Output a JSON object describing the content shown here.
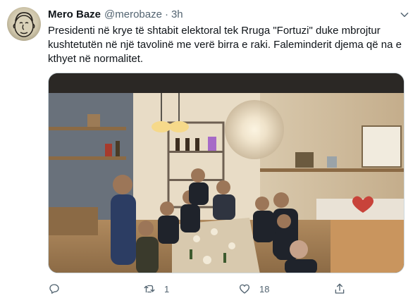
{
  "tweet": {
    "author": {
      "display_name": "Mero Baze",
      "handle": "@merobaze",
      "separator": "·",
      "time": "3h"
    },
    "text": "Presidenti në krye të shtabit elektoral tek Rruga \"Fortuzi\" duke mbrojtur kushtetutën në një tavolinë me verë birra e raki. Faleminderit djema që na e kthyet në normalitet.",
    "icons": {
      "more": "more-options-icon",
      "reply": "reply-icon",
      "retweet": "retweet-icon",
      "like": "like-icon",
      "share": "share-icon"
    },
    "counts": {
      "replies": "",
      "retweets": "1",
      "likes": "18"
    },
    "colors": {
      "text": "#0f1419",
      "secondary": "#536471",
      "border": "#cfd9de"
    }
  }
}
